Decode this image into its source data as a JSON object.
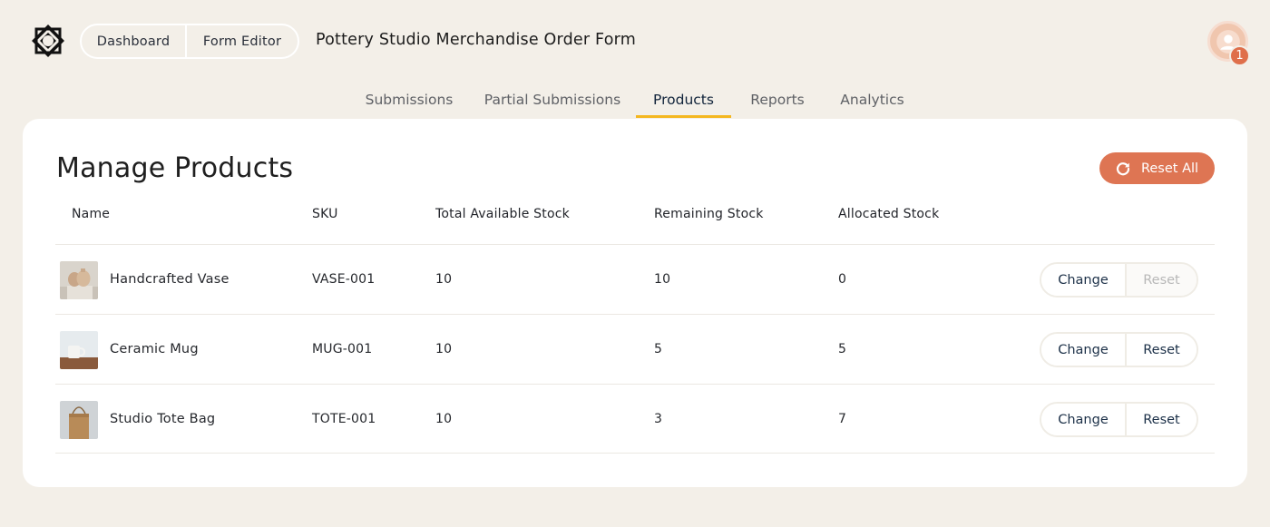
{
  "header": {
    "nav": {
      "dashboard_label": "Dashboard",
      "form_editor_label": "Form Editor"
    },
    "form_title": "Pottery Studio Merchandise Order Form",
    "notification_count": "1"
  },
  "tabs": [
    {
      "label": "Submissions",
      "active": false
    },
    {
      "label": "Partial Submissions",
      "active": false
    },
    {
      "label": "Products",
      "active": true
    },
    {
      "label": "Reports",
      "active": false
    },
    {
      "label": "Analytics",
      "active": false
    }
  ],
  "main": {
    "title": "Manage Products",
    "reset_all_label": "Reset All",
    "columns": {
      "name": "Name",
      "sku": "SKU",
      "total": "Total Available Stock",
      "remaining": "Remaining Stock",
      "allocated": "Allocated Stock"
    },
    "rows": [
      {
        "name": "Handcrafted Vase",
        "sku": "VASE-001",
        "total": "10",
        "remaining": "10",
        "allocated": "0",
        "change_label": "Change",
        "reset_label": "Reset",
        "reset_disabled": true,
        "thumb": "vase-image"
      },
      {
        "name": "Ceramic Mug",
        "sku": "MUG-001",
        "total": "10",
        "remaining": "5",
        "allocated": "5",
        "change_label": "Change",
        "reset_label": "Reset",
        "reset_disabled": false,
        "thumb": "mug-image"
      },
      {
        "name": "Studio Tote Bag",
        "sku": "TOTE-001",
        "total": "10",
        "remaining": "3",
        "allocated": "7",
        "change_label": "Change",
        "reset_label": "Reset",
        "reset_disabled": false,
        "thumb": "tote-image"
      }
    ]
  },
  "colors": {
    "background": "#f3efe8",
    "accent": "#de7553",
    "tab_underline": "#f4b71f",
    "card": "#ffffff"
  }
}
